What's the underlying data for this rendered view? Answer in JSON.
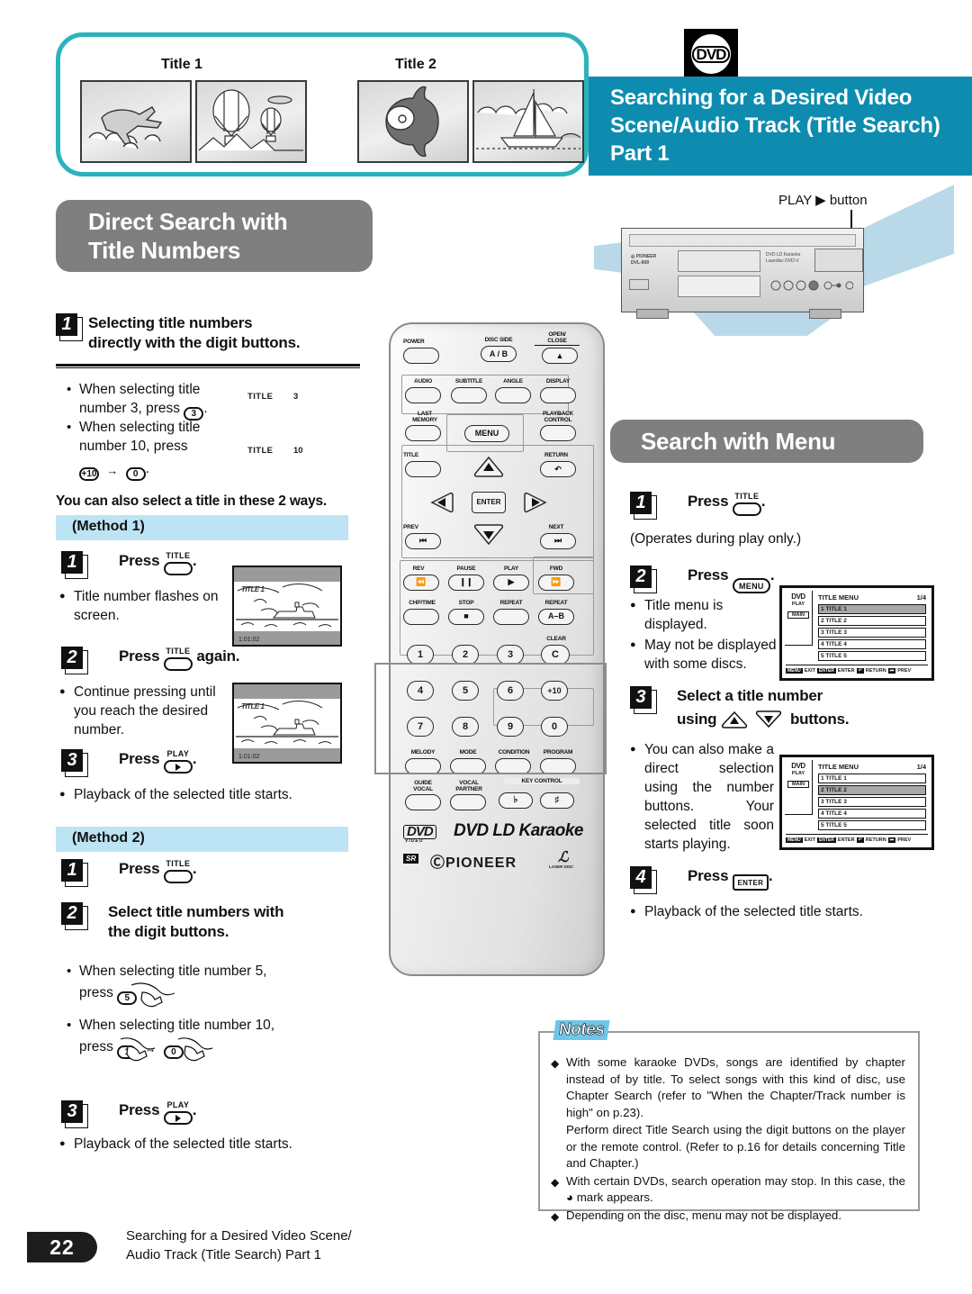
{
  "header": {
    "dvd_badge": "DVD",
    "title": "Searching for a Desired Video Scene/Audio Track (Title Search) Part 1"
  },
  "illustration": {
    "title1_label": "Title 1",
    "title2_label": "Title 2",
    "scenes": [
      "airplane-in-clouds",
      "hot-air-balloons",
      "sunfish",
      "sailboat"
    ]
  },
  "player_callout": {
    "text": "PLAY ▶ button"
  },
  "left_column": {
    "section_title_line1": "Direct Search with",
    "section_title_line2": "Title Numbers",
    "step1": {
      "num": "1",
      "line1": "Selecting title numbers",
      "line2": "directly with the digit buttons."
    },
    "bullets": [
      "When selecting  title number 3, press",
      "When selecting title number 10, press"
    ],
    "title_display_1": {
      "label": "TITLE",
      "value": "3"
    },
    "title_display_2": {
      "label": "TITLE",
      "value": "10"
    },
    "two_ways_text": "You can also select a title in these 2 ways.",
    "method1_label": "(Method 1)",
    "method1": {
      "s1_num": "1",
      "s1_text": "Press",
      "s1_key": "TITLE",
      "s1_note": "Title      number flashes on screen.",
      "s2_num": "2",
      "s2_text": "Press",
      "s2_key": "TITLE",
      "s2_tail": "again.",
      "s2_note": "Continue pressing until you reach the desired number.",
      "s3_num": "3",
      "s3_text": "Press",
      "s3_key": "PLAY",
      "s3_note": "Playback of the selected title starts."
    },
    "method2_label": "(Method 2)",
    "method2": {
      "s1_num": "1",
      "s1_text": "Press",
      "s1_key": "TITLE",
      "s2_num": "2",
      "s2_line1": "Select title numbers with",
      "s2_line2": "the digit buttons.",
      "b1": "When selecting title number 5,",
      "b1_press": "press",
      "b2": "When selecting title number 10,",
      "b2_press": "press",
      "s3_num": "3",
      "s3_text": "Press",
      "s3_key": "PLAY",
      "s3_note": "Playback of the selected title starts."
    }
  },
  "right_column": {
    "section_title": "Search with Menu",
    "step1": {
      "num": "1",
      "text": "Press",
      "key": "TITLE",
      "note": "(Operates during play only.)"
    },
    "step2": {
      "num": "2",
      "text": "Press",
      "key": "MENU",
      "note1": "Title menu is displayed.",
      "note2": "May not be displayed with some discs."
    },
    "step3": {
      "num": "3",
      "line1": "Select a title number",
      "line2_pre": "using",
      "line2_post": "buttons.",
      "note": "You can also make a direct selection using the number buttons. Your selected title soon starts playing."
    },
    "step4": {
      "num": "4",
      "text": "Press",
      "key": "ENTER",
      "note": "Playback of the selected title starts."
    },
    "osd1": {
      "dvd": "DVD",
      "play": "PLAY",
      "main": "MAIN",
      "title": "TITLE MENU",
      "page": "1/4",
      "rows": [
        "1 TITLE 1",
        "2 TITLE 2",
        "3 TITLE 3",
        "4 TITLE 4",
        "5 TITLE 5"
      ],
      "selected": 0,
      "footer": [
        "MENU",
        "EXIT",
        "ENTER",
        "ENTER",
        "RETURN",
        "PREV"
      ]
    },
    "osd2": {
      "dvd": "DVD",
      "play": "PLAY",
      "main": "MAIN",
      "title": "TITLE MENU",
      "page": "1/4",
      "rows": [
        "1 TITLE 1",
        "2 TITLE 2",
        "3 TITLE 3",
        "4 TITLE 4",
        "5 TITLE 5"
      ],
      "selected": 1,
      "footer": [
        "MENU",
        "EXIT",
        "ENTER",
        "ENTER",
        "RETURN",
        "PREV"
      ]
    }
  },
  "tv_shots": {
    "shot1": {
      "overlay": "TITLE 1",
      "timecode": "1:01:02"
    },
    "shot2": {
      "overlay": "TITLE 1",
      "timecode": "1:01:02"
    }
  },
  "remote": {
    "labels": {
      "power": "POWER",
      "disc_side": "DISC SIDE",
      "disc_side_key": "A / B",
      "open_close": "OPEN/\nCLOSE",
      "audio": "AUDIO",
      "subtitle": "SUBTITLE",
      "angle": "ANGLE",
      "display": "DISPLAY",
      "last_memory": "LAST\nMEMORY",
      "menu": "MENU",
      "playback_control": "PLAYBACK\nCONTROL",
      "title": "TITLE",
      "return": "RETURN",
      "enter": "ENTER",
      "prev": "PREV",
      "next": "NEXT",
      "rev": "REV",
      "pause": "PAUSE",
      "play": "PLAY",
      "fwd": "FWD",
      "chp_time": "CHP/TIME",
      "stop": "STOP",
      "repeat": "REPEAT",
      "repeat_ab": "REPEAT",
      "repeat_ab_key": "A–B",
      "clear": "CLEAR",
      "clear_key": "C",
      "melody": "MELODY",
      "mode": "MODE",
      "condition": "CONDITION",
      "program": "PROGRAM",
      "guide_vocal": "GUIDE\nVOCAL",
      "vocal_partner": "VOCAL\nPARTNER",
      "key_control": "KEY CONTROL",
      "key_flat": "♭",
      "key_sharp": "♯"
    },
    "digits": [
      "1",
      "2",
      "3",
      "4",
      "5",
      "6",
      "7",
      "8",
      "9",
      "0"
    ],
    "plus10": "+10",
    "brand_dvd_video": "DVD",
    "brand_dvd_video_sub": "VIDEO",
    "brand_line": "DVD LD Karaoke",
    "brand_sr": "SR",
    "brand_pioneer": "PIONEER",
    "brand_laserdisc": "LASER DISC"
  },
  "notes": {
    "tag": "Notes",
    "items": [
      "With some karaoke DVDs, songs are identified by chapter instead of by title. To select songs with this kind of disc, use Chapter Search (refer to \"When the Chapter/Track number is high\" on p.23).",
      "Perform direct Title Search using the digit buttons on the player or the remote control. (Refer to p.16 for details concerning Title and Chapter.)",
      "With certain DVDs, search operation may stop. In this case, the ◕ mark appears.",
      "Depending on the disc, menu may not be displayed."
    ]
  },
  "footer": {
    "page_number": "22",
    "title_line1": "Searching for a Desired Video Scene/",
    "title_line2": "Audio Track (Title Search) Part 1"
  },
  "colors": {
    "teal_header": "#0d8cb0",
    "teal_outline": "#2bb3bd",
    "gray_pill": "#7f7f7f",
    "method_blue": "#bde4f5",
    "notes_tag_blue": "#6ec6e8",
    "beam_blue": "#b9d9e8"
  }
}
